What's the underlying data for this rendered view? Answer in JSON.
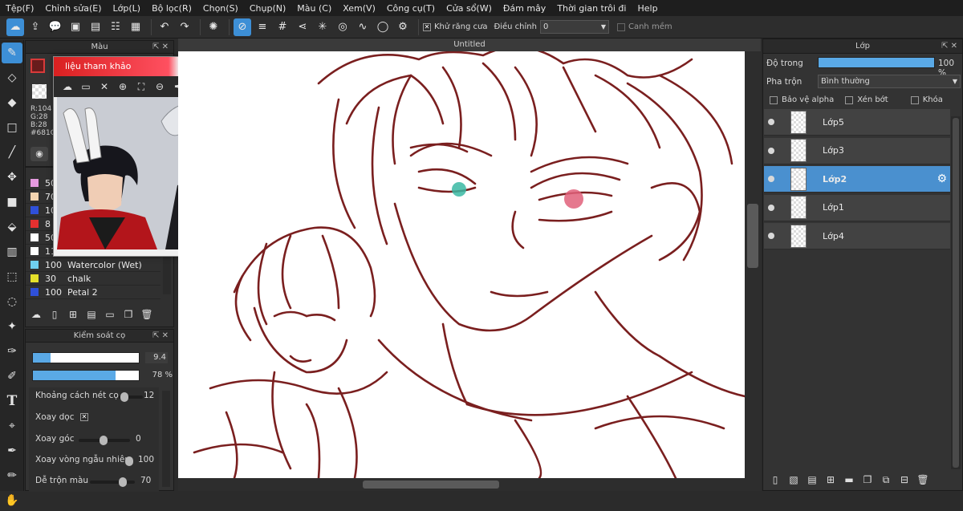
{
  "menu": [
    "Tệp(F)",
    "Chỉnh sửa(E)",
    "Lớp(L)",
    "Bộ lọc(R)",
    "Chọn(S)",
    "Chụp(N)",
    "Màu (C)",
    "Xem(V)",
    "Công cụ(T)",
    "Cửa sổ(W)",
    "Đám mây",
    "Thời gian trôi đi",
    "Help"
  ],
  "toolbar": {
    "antialias_label": "Khử răng cưa",
    "adjust_label": "Điều chỉnh",
    "adjust_value": "0",
    "snap_label": "Canh mềm"
  },
  "color_panel": {
    "title": "Màu",
    "r": "R:104",
    "g": "G:28",
    "b": "B:28",
    "hex": "#681C1",
    "fg_color": "#681c1c"
  },
  "reference_window": {
    "title": "liệu tham khảo"
  },
  "brush_list": [
    {
      "size": "50",
      "name": "",
      "color": "#e59adf"
    },
    {
      "size": "70",
      "name": "",
      "color": "#f3d3b0"
    },
    {
      "size": "10",
      "name": "",
      "color": "#2f50d9"
    },
    {
      "size": "8",
      "name": "",
      "color": "#e53030"
    },
    {
      "size": "50",
      "name": "",
      "color": "#ffffff"
    },
    {
      "size": "11",
      "name": "",
      "color": "#ffffff"
    },
    {
      "size": "100",
      "name": "Watercolor (Wet)",
      "color": "#6fcff0"
    },
    {
      "size": "30",
      "name": "chalk",
      "color": "#e5e02a"
    },
    {
      "size": "100",
      "name": "Petal 2",
      "color": "#2f50d9"
    }
  ],
  "brush_control": {
    "title": "Kiểm soát cọ",
    "size_value": "9.4",
    "opacity_value": "78 %",
    "opacity_fraction": 0.78,
    "size_fraction": 0.17,
    "spacing_label": "Khoảng cách nét cọ",
    "spacing_value": "12",
    "rotate_v_label": "Xoay dọc",
    "angle_label": "Xoay góc",
    "angle_value": "0",
    "random_label": "Xoay vòng ngẫu nhiên",
    "random_value": "100",
    "blend_label": "Dễ trộn màu",
    "blend_value": "70"
  },
  "canvas": {
    "tab_title": "Untitled"
  },
  "layers": {
    "title": "Lớp",
    "opacity_label": "Độ trong",
    "opacity_value": "100 %",
    "opacity_fraction": 1.0,
    "blend_label": "Pha trộn",
    "blend_value": "Bình thường",
    "protect_alpha": "Bảo vệ alpha",
    "clip": "Xén bớt",
    "lock": "Khóa",
    "items": [
      "Lớp5",
      "Lớp3",
      "Lớp2",
      "Lớp1",
      "Lớp4"
    ],
    "selected_index": 2
  },
  "colors": {
    "accent": "#3d8fd6",
    "sketch": "#7a1f1f",
    "eye_left": "#39b8a3",
    "eye_right": "#e0607a"
  }
}
